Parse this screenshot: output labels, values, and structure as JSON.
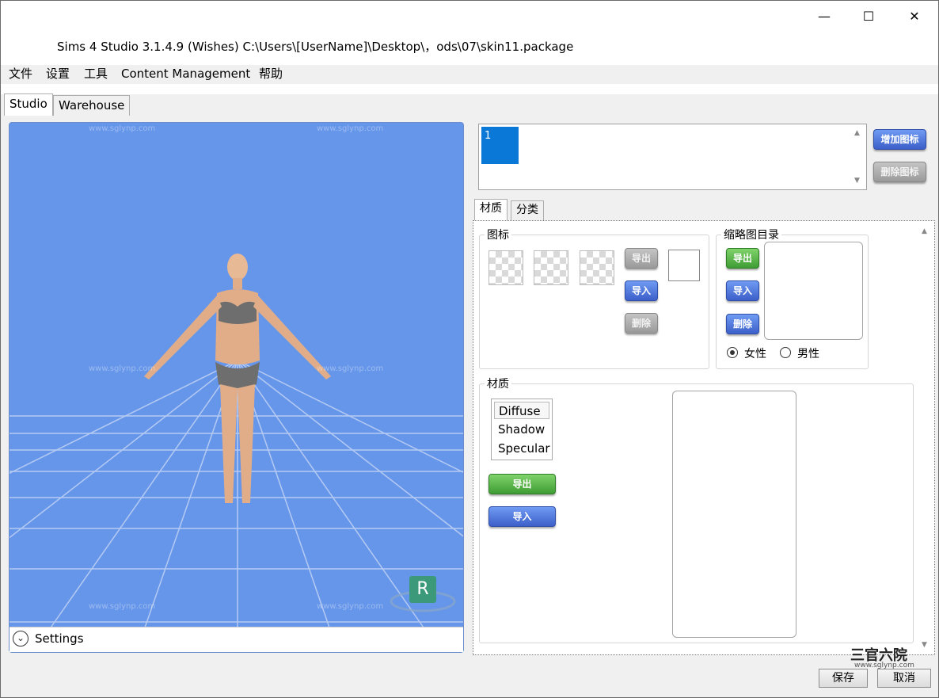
{
  "window": {
    "title": "Sims 4 Studio 3.1.4.9 (Wishes)  C:\\Users\\[UserName]\\Desktop\\，ods\\07\\skin11.package",
    "minimize_glyph": "—",
    "maximize_glyph": "☐",
    "close_glyph": "✕"
  },
  "menu": {
    "items": [
      "文件",
      "设置",
      "工具",
      "Content Management",
      "帮助"
    ]
  },
  "tabs": {
    "main": [
      "Studio",
      "Warehouse"
    ],
    "active": "Studio"
  },
  "viewport": {
    "background_color": "#6696ea",
    "settings_label": "Settings",
    "settings_icon": "chevron-down-circle-icon",
    "view_badge": "R",
    "watermark_url": "www.sglynp.com"
  },
  "swatch_list": {
    "items": [
      "1"
    ],
    "add_icon_button": "增加图标",
    "remove_icon_button": "删除图标"
  },
  "inner_tabs": {
    "items": [
      "材质",
      "分类"
    ],
    "active": "材质"
  },
  "icon_group": {
    "title": "图标",
    "export_button": "导出",
    "import_button": "导入",
    "delete_button": "删除"
  },
  "thumbnail_group": {
    "title": "缩略图目录",
    "export_button": "导出",
    "import_button": "导入",
    "delete_button": "删除",
    "gender_options": [
      "女性",
      "男性"
    ],
    "gender_selected": "女性"
  },
  "material_group": {
    "title": "材质",
    "items": [
      "Diffuse",
      "Shadow",
      "Specular"
    ],
    "selected": "Diffuse",
    "export_button": "导出",
    "import_button": "导入"
  },
  "footer": {
    "save_button": "保存",
    "cancel_button": "取消",
    "logo_text": "三官六院",
    "logo_url": "www.sglynp.com"
  }
}
